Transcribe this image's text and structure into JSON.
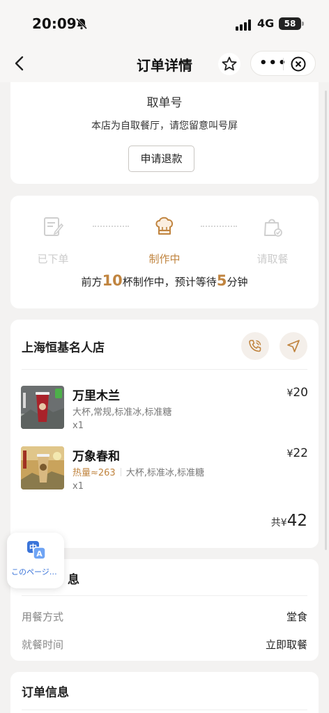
{
  "status_bar": {
    "time": "20:09",
    "network": "4G",
    "battery": "58"
  },
  "nav": {
    "title": "订单详情"
  },
  "pickup": {
    "number_partial": "",
    "number_label": "取单号",
    "note": "本店为自取餐厅，请您留意叫号屏",
    "refund_label": "申请退款"
  },
  "progress": {
    "steps": [
      {
        "label": "已下单"
      },
      {
        "label": "制作中"
      },
      {
        "label": "请取餐"
      }
    ],
    "queue_prefix": "前方",
    "queue_cups": "10",
    "queue_mid": "杯制作中，预计等待",
    "queue_minutes": "5",
    "queue_suffix": "分钟"
  },
  "store": {
    "name": "上海恒基名人店",
    "items": [
      {
        "name": "万里木兰",
        "spec": "大杯,常规,标准冰,标准糖",
        "calories": "",
        "qty": "x1",
        "currency": "¥",
        "price": "20"
      },
      {
        "name": "万象春和",
        "spec": "大杯,标准冰,标准糖",
        "calories": "热量≈263",
        "qty": "x1",
        "currency": "¥",
        "price": "22"
      }
    ],
    "total_label": "共",
    "total_currency": "¥",
    "total_amount": "42"
  },
  "dining": {
    "title_partial": "息",
    "rows": [
      {
        "key": "用餐方式",
        "value": "堂食"
      },
      {
        "key": "就餐时间",
        "value": "立即取餐"
      }
    ]
  },
  "order_info": {
    "title": "订单信息"
  },
  "translate": {
    "label": "このページ…"
  },
  "colors": {
    "accent": "#c0843f",
    "background": "#f3f2f1",
    "link": "#3a74d9"
  }
}
